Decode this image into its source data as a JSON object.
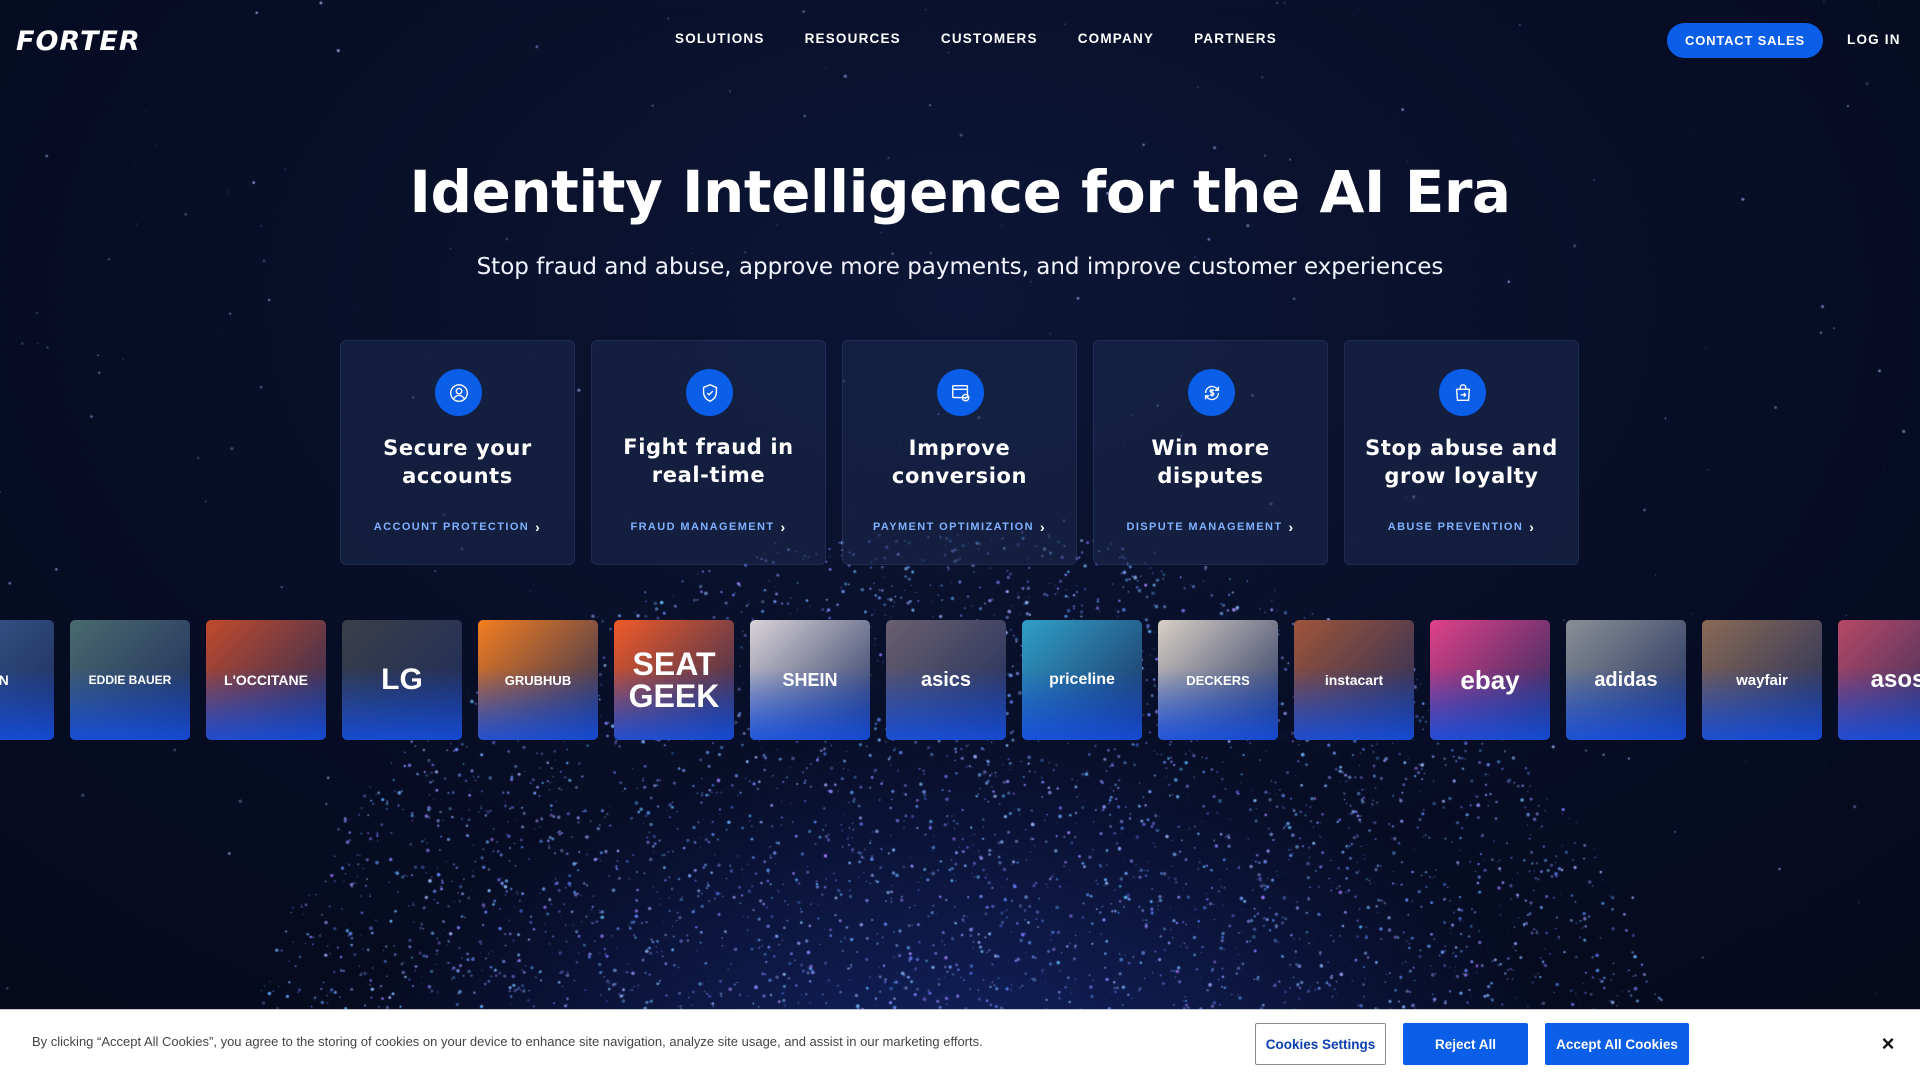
{
  "header": {
    "logo_text": "FORTER",
    "nav": [
      "SOLUTIONS",
      "RESOURCES",
      "CUSTOMERS",
      "COMPANY",
      "PARTNERS"
    ],
    "contact_label": "CONTACT SALES",
    "login_label": "LOG IN"
  },
  "hero": {
    "title": "Identity Intelligence for the AI Era",
    "subtitle": "Stop fraud and abuse, approve more payments, and improve customer experiences"
  },
  "cards": [
    {
      "icon": "user-circle-icon",
      "title": "Secure your accounts",
      "link": "ACCOUNT PROTECTION"
    },
    {
      "icon": "shield-check-icon",
      "title": "Fight fraud in real-time",
      "link": "FRAUD MANAGEMENT"
    },
    {
      "icon": "payment-screen-icon",
      "title": "Improve conversion",
      "link": "PAYMENT OPTIMIZATION"
    },
    {
      "icon": "dollar-cycle-icon",
      "title": "Win more disputes",
      "link": "DISPUTE MANAGEMENT"
    },
    {
      "icon": "shopping-bag-arrow-icon",
      "title": "Stop abuse and grow loyalty",
      "link": "ABUSE PREVENTION"
    }
  ],
  "customer_logos": [
    {
      "label": "SUN",
      "bg": "#3a5c8e"
    },
    {
      "label": "EDDIE BAUER",
      "bg": "#4a6a70"
    },
    {
      "label": "L'OCCITANE",
      "bg": "#c24a2c"
    },
    {
      "label": "LG",
      "bg": "#3b3f4a"
    },
    {
      "label": "GRUBHUB",
      "bg": "#f47d1f"
    },
    {
      "label": "SEAT GEEK",
      "bg": "#f05a28"
    },
    {
      "label": "SHEIN",
      "bg": "#d9d3d8"
    },
    {
      "label": "asics",
      "bg": "#6a6070"
    },
    {
      "label": "priceline",
      "bg": "#2fa0c8"
    },
    {
      "label": "DECKERS",
      "bg": "#d8cfc5"
    },
    {
      "label": "instacart",
      "bg": "#a0553a"
    },
    {
      "label": "ebay",
      "bg": "#e0408a"
    },
    {
      "label": "adidas",
      "bg": "#8a8f96"
    },
    {
      "label": "wayfair",
      "bg": "#8a6a55"
    },
    {
      "label": "asos",
      "bg": "#b74866"
    }
  ],
  "cookie": {
    "text": "By clicking “Accept All Cookies”, you agree to the storing of cookies on your device to enhance site navigation, analyze site usage, and assist in our marketing efforts.",
    "settings_label": "Cookies Settings",
    "reject_label": "Reject All",
    "accept_label": "Accept All Cookies",
    "close_label": "×"
  },
  "colors": {
    "accent": "#0a5ee8",
    "link": "#7fb0ff",
    "background": "#070d25"
  }
}
